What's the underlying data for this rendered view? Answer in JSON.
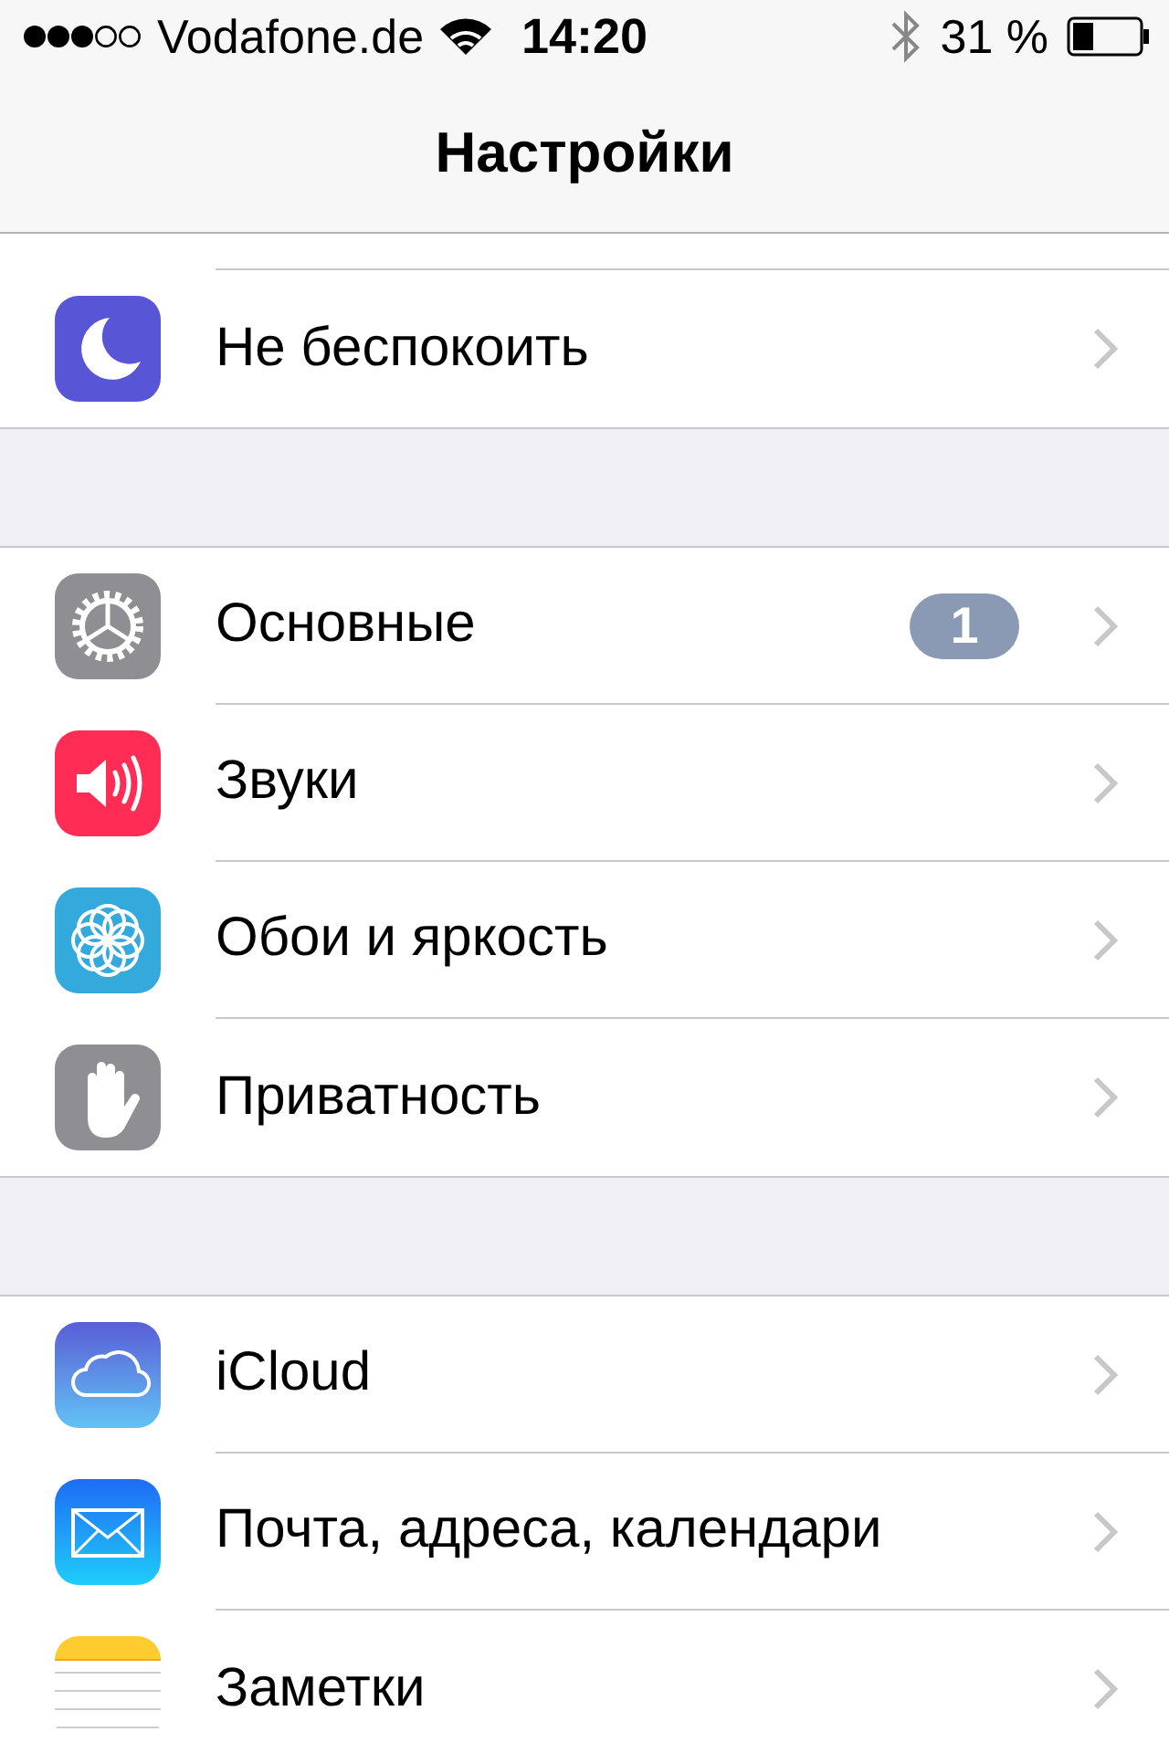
{
  "status_bar": {
    "carrier": "Vodafone.de",
    "time": "14:20",
    "battery": "31 %"
  },
  "nav_bar": {
    "title": "Настройки"
  },
  "groups": [
    {
      "rows": [
        {
          "kind": "moon",
          "label": "Не беспокоить"
        }
      ]
    },
    {
      "rows": [
        {
          "kind": "gear",
          "label": "Основные",
          "badge": "1"
        },
        {
          "kind": "sound",
          "label": "Звуки"
        },
        {
          "kind": "flower",
          "label": "Обои и яркость"
        },
        {
          "kind": "hand",
          "label": "Приватность"
        }
      ]
    },
    {
      "rows": [
        {
          "kind": "cloud",
          "label": "iCloud"
        },
        {
          "kind": "mail",
          "label": "Почта, адреса, календари"
        },
        {
          "kind": "notes",
          "label": "Заметки"
        }
      ]
    }
  ]
}
